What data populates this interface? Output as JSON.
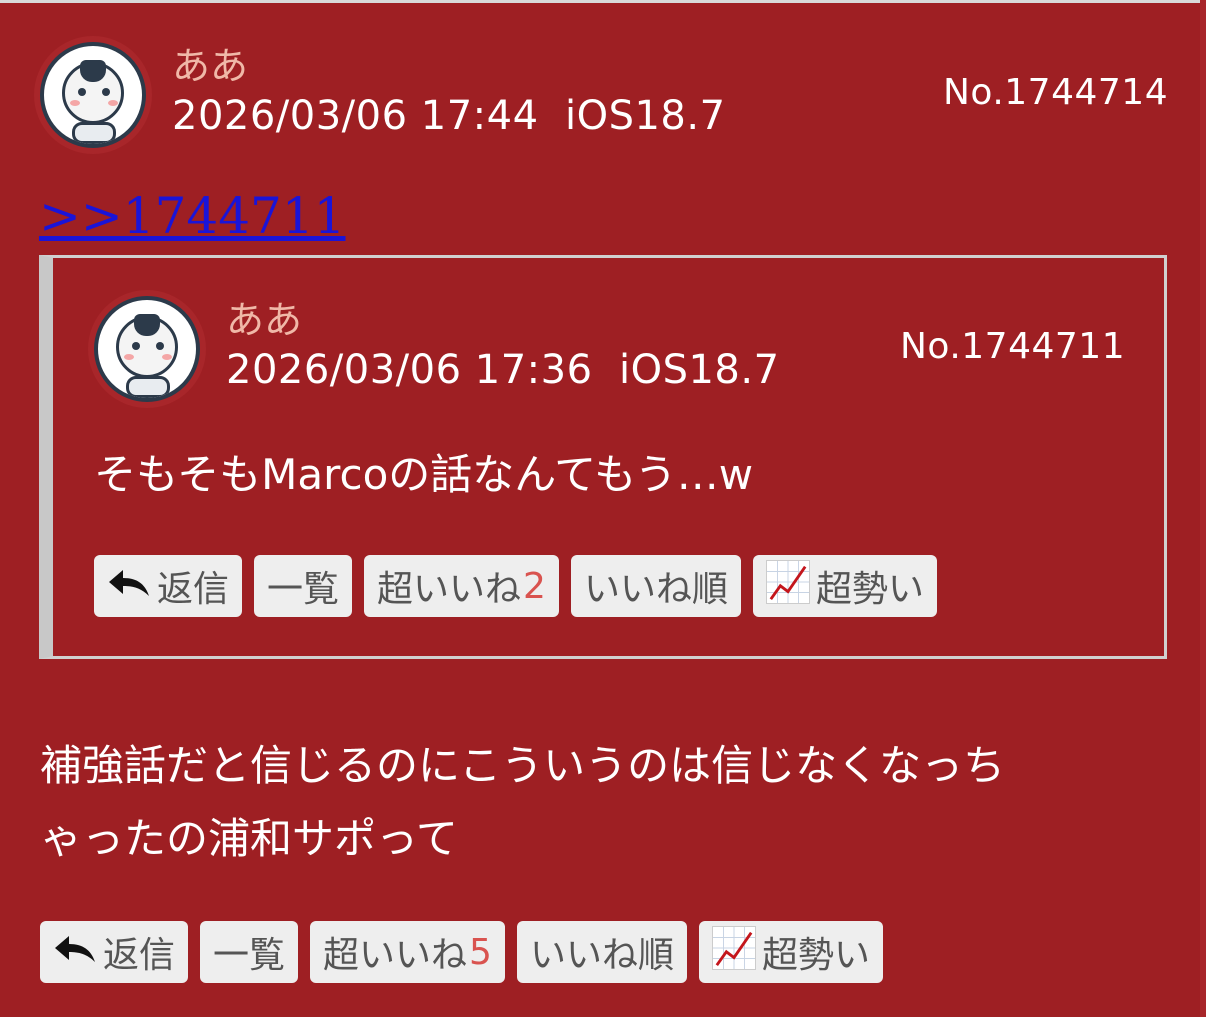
{
  "post": {
    "author": "ああ",
    "datetime": "2026/03/06 17:44  iOS18.7",
    "post_no": "No.1744714",
    "reply_link": ">>1744711",
    "body_line1": "補強話だと信じるのにこういうのは信じなくなっち",
    "body_line2": "ゃったの浦和サポって",
    "actions": {
      "reply": "返信",
      "list": "一覧",
      "super_like": "超いいね",
      "super_like_count": "5",
      "like_order": "いいね順",
      "momentum": "超勢い"
    }
  },
  "quoted": {
    "author": "ああ",
    "datetime": "2026/03/06 17:36  iOS18.7",
    "post_no": "No.1744711",
    "body": "そもそもMarcoの話なんてもう…w",
    "actions": {
      "reply": "返信",
      "list": "一覧",
      "super_like": "超いいね",
      "super_like_count": "2",
      "like_order": "いいね順",
      "momentum": "超勢い"
    }
  },
  "icons": {
    "avatar": "soccer-ball-mascot",
    "reply": "reply-arrow-icon",
    "momentum": "chart-increasing-icon"
  },
  "colors": {
    "background": "#9e1f23",
    "author": "#f0b8a8",
    "link": "#1a14d8",
    "count": "#d9534f"
  }
}
